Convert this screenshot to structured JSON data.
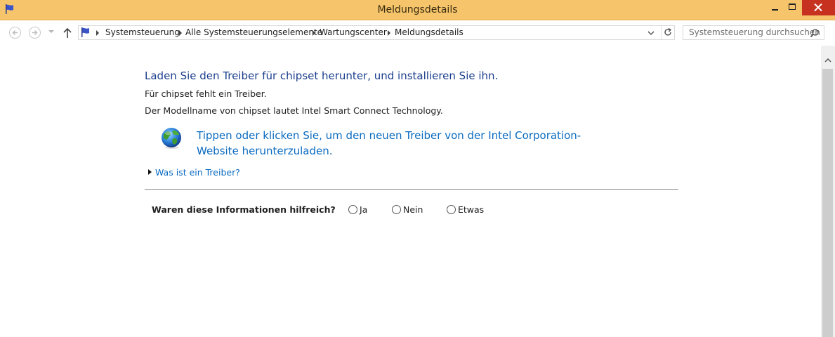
{
  "window": {
    "title": "Meldungsdetails",
    "colors": {
      "titlebar": "#f5c46b",
      "close": "#c7311f",
      "link": "#0b6bc0",
      "heading": "#1a3e8c"
    },
    "icons": [
      "flag-icon",
      "minimize-icon",
      "maximize-icon",
      "close-icon"
    ]
  },
  "nav": {
    "icons": [
      "back-arrow-icon",
      "forward-arrow-icon",
      "history-dropdown-icon",
      "up-arrow-icon",
      "flag-icon",
      "address-dropdown-icon",
      "refresh-icon",
      "search-icon"
    ],
    "breadcrumb": [
      "Systemsteuerung",
      "Alle Systemsteuerungselemente",
      "Wartungscenter",
      "Meldungsdetails"
    ],
    "search_placeholder": "Systemsteuerung durchsuchen"
  },
  "message": {
    "heading": "Laden Sie den Treiber für chipset herunter, und installieren Sie ihn.",
    "line1": "Für chipset fehlt ein Treiber.",
    "line2": "Der Modellname von chipset lautet Intel Smart Connect Technology.",
    "download_link_line1": "Tippen oder klicken Sie, um den neuen Treiber von der Intel Corporation-",
    "download_link_line2": "Website herunterzuladen.",
    "download_icon": "globe-icon",
    "expand_link": "Was ist ein Treiber?"
  },
  "feedback": {
    "question": "Waren diese Informationen hilfreich?",
    "options": [
      "Ja",
      "Nein",
      "Etwas"
    ],
    "selected": null
  }
}
